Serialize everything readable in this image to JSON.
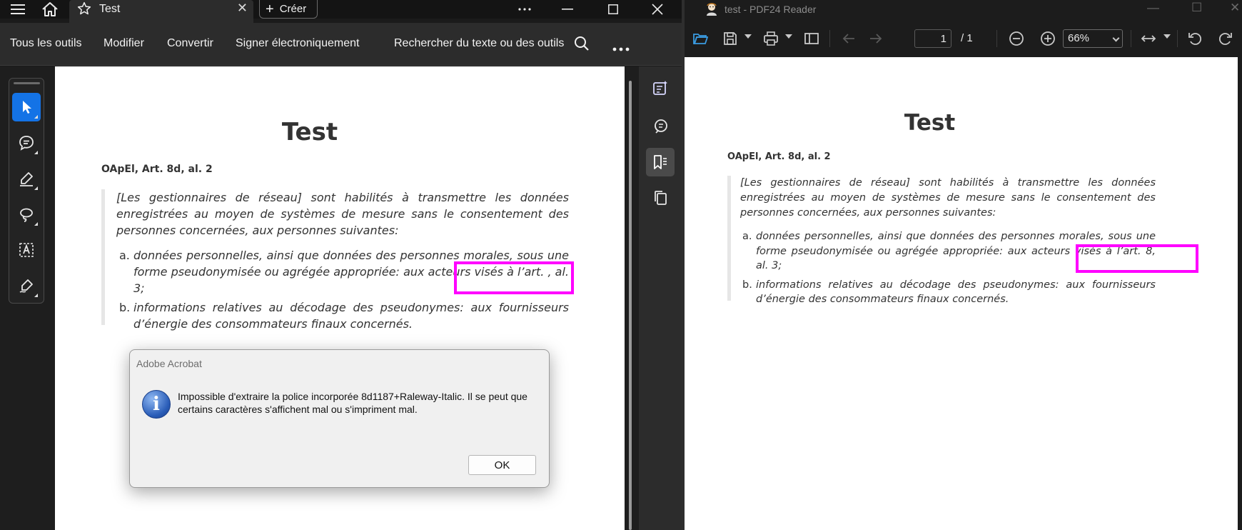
{
  "acrobat": {
    "tab_label": "Test",
    "create_label": "Créer",
    "toolbar": {
      "all_tools": "Tous les outils",
      "edit": "Modifier",
      "convert": "Convertir",
      "esign": "Signer électroniquement",
      "search": "Rechercher du texte ou des outils"
    },
    "dialog": {
      "title": "Adobe Acrobat",
      "message": "Impossible d'extraire la police incorporée 8d1187+Raleway-Italic. Il se peut que certains caractères s'affichent mal ou s'impriment mal.",
      "ok": "OK"
    }
  },
  "pdf24": {
    "window_title": "test - PDF24 Reader",
    "page_current": "1",
    "page_total": "/  1",
    "zoom": "66%"
  },
  "doc_left": {
    "title": "Test",
    "ref": "OApEl, Art. 8d, al. 2",
    "intro": "[Les gestionnaires de réseau] sont habilités à transmettre les données enregistrées au moyen de systèmes de mesure sans le consentement des personnes concernées, aux personnes suivantes:",
    "items": [
      {
        "marker": "a.",
        "text": "données personnelles, ainsi que données des personnes morales, sous une forme pseudonymisée ou agrégée appropriée: aux acteurs visés à l’art.   , al. 3;"
      },
      {
        "marker": "b.",
        "text": "informations relatives au décodage des pseudonymes: aux fournisseurs d’énergie des consommateurs finaux concernés."
      }
    ]
  },
  "doc_right": {
    "title": "Test",
    "ref": "OApEl, Art. 8d, al. 2",
    "intro": "[Les gestionnaires de réseau] sont habilités à transmettre les données enregistrées au moyen de systèmes de mesure sans le consentement des personnes concernées, aux personnes suivantes:",
    "items": [
      {
        "marker": "a.",
        "text": "données personnelles, ainsi que données des personnes morales, sous une forme pseudonymisée ou agrégée appropriée: aux acteurs visés à l’art. 8, al. 3;"
      },
      {
        "marker": "b.",
        "text": "informations relatives au décodage des pseudonymes: aux fournisseurs d’énergie des consommateurs finaux concernés."
      }
    ]
  },
  "colors": {
    "highlight": "#ff00ff",
    "acrobat_blue": "#1473e6"
  },
  "icons": [
    "hamburger-icon",
    "home-icon",
    "star-icon",
    "close-icon",
    "plus-icon",
    "more-icon",
    "minimize-icon",
    "maximize-icon",
    "search-icon",
    "pointer-icon",
    "comment-icon",
    "pen-icon",
    "lasso-icon",
    "text-select-icon",
    "sign-icon",
    "open-folder-icon",
    "save-icon",
    "print-icon",
    "sidebar-icon",
    "arrow-left-icon",
    "arrow-right-icon",
    "zoom-out-icon",
    "zoom-in-icon",
    "fit-width-icon",
    "rotate-left-icon",
    "rotate-right-icon"
  ]
}
